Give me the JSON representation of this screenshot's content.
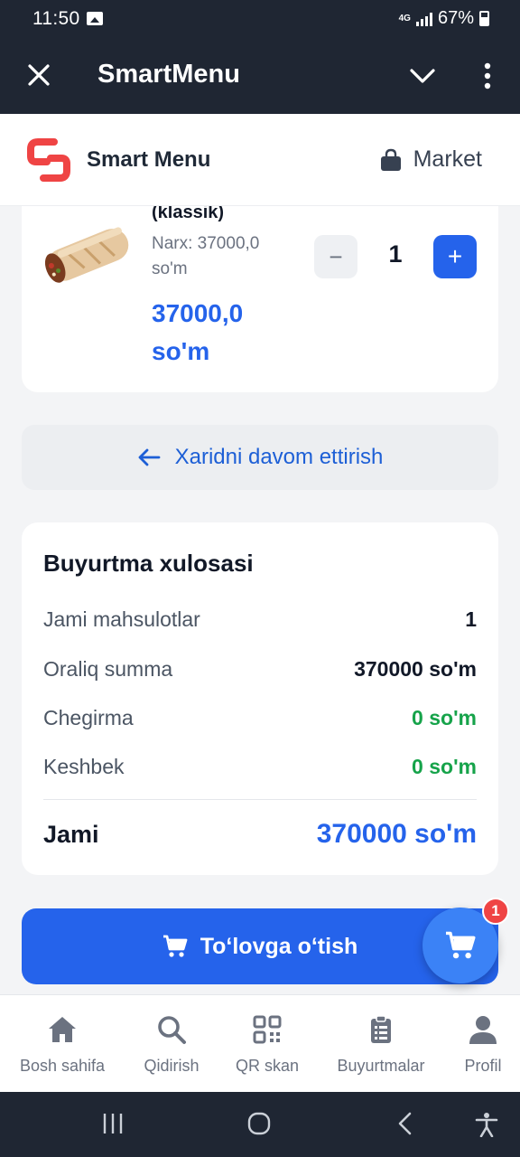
{
  "status_bar": {
    "time": "11:50",
    "network": "4G",
    "battery": "67%"
  },
  "app_bar": {
    "title": "SmartMenu"
  },
  "site_header": {
    "brand": "Smart Menu",
    "market_label": "Market"
  },
  "cart_item": {
    "name": "(klassik)",
    "price_text": "Narx: 37000,0 so'm",
    "total_text": "37000,0 so'm",
    "quantity": "1",
    "minus": "−",
    "plus": "+"
  },
  "continue_shopping": "Xaridni davom ettirish",
  "summary": {
    "title": "Buyurtma xulosasi",
    "rows": [
      {
        "label": "Jami mahsulotlar",
        "value": "1"
      },
      {
        "label": "Oraliq summa",
        "value": "370000 so'm"
      },
      {
        "label": "Chegirma",
        "value": "0 so'm"
      },
      {
        "label": "Keshbek",
        "value": "0 so'm"
      }
    ],
    "total_label": "Jami",
    "total_value": "370000 so'm"
  },
  "checkout_button": "To‘lovga o‘tish",
  "cart_badge": "1",
  "bottom_nav": [
    {
      "label": "Bosh sahifa",
      "icon": "home-icon"
    },
    {
      "label": "Qidirish",
      "icon": "search-icon"
    },
    {
      "label": "QR skan",
      "icon": "qr-icon"
    },
    {
      "label": "Buyurtmalar",
      "icon": "clipboard-icon"
    },
    {
      "label": "Profil",
      "icon": "user-icon"
    }
  ],
  "colors": {
    "primary": "#2563eb",
    "dark": "#1f2633",
    "green": "#16a34a",
    "badge": "#ef4444"
  }
}
